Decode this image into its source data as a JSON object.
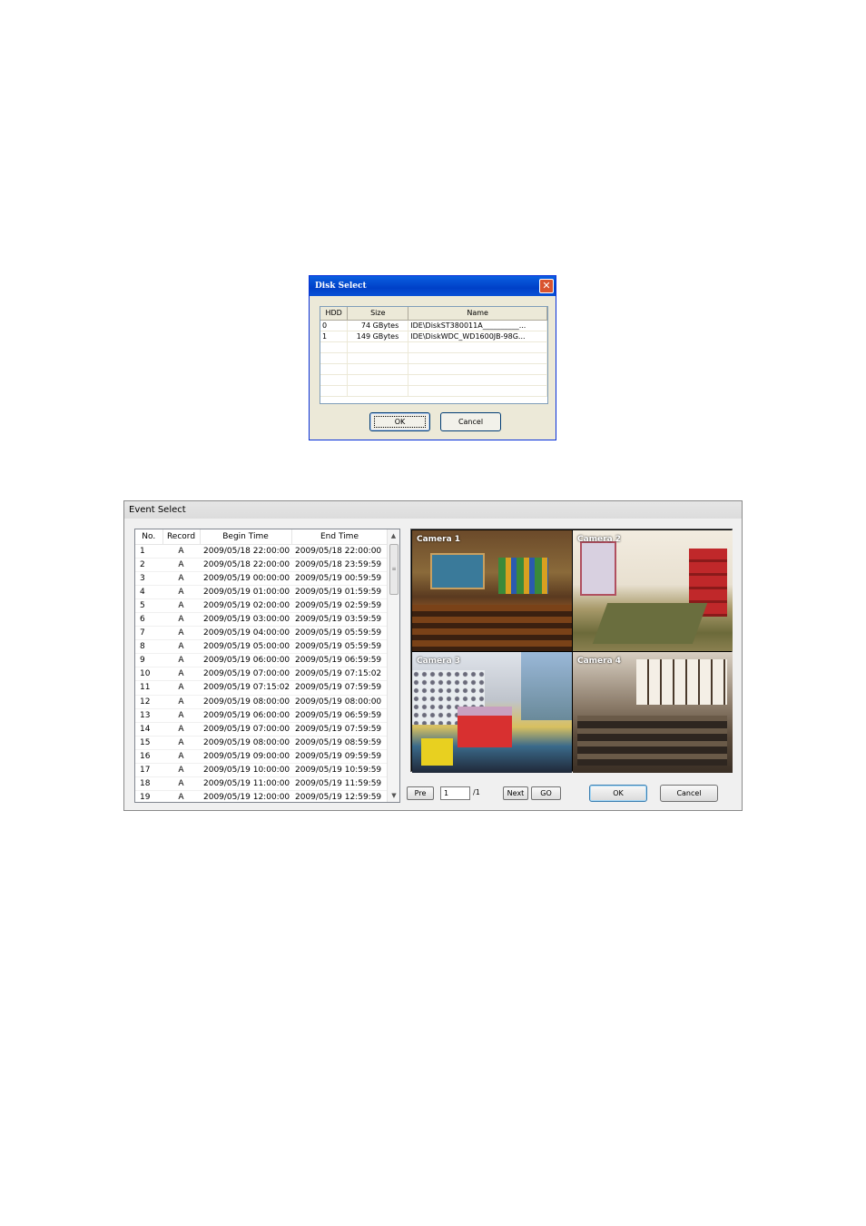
{
  "disk_select": {
    "title": "Disk Select",
    "close_glyph": "✕",
    "columns": [
      "HDD",
      "Size",
      "Name"
    ],
    "rows": [
      {
        "hdd": "0",
        "size": "74 GBytes",
        "name": "IDE\\DiskST380011A__________..."
      },
      {
        "hdd": "1",
        "size": "149 GBytes",
        "name": "IDE\\DiskWDC_WD1600JB-98G..."
      }
    ],
    "ok_label": "OK",
    "cancel_label": "Cancel"
  },
  "event_select": {
    "title": "Event Select",
    "columns": [
      "No.",
      "Record",
      "Begin Time",
      "End Time"
    ],
    "rows": [
      {
        "no": "1",
        "record": "A",
        "begin": "2009/05/18 22:00:00",
        "end": "2009/05/18 22:00:00"
      },
      {
        "no": "2",
        "record": "A",
        "begin": "2009/05/18 22:00:00",
        "end": "2009/05/18 23:59:59"
      },
      {
        "no": "3",
        "record": "A",
        "begin": "2009/05/19 00:00:00",
        "end": "2009/05/19 00:59:59"
      },
      {
        "no": "4",
        "record": "A",
        "begin": "2009/05/19 01:00:00",
        "end": "2009/05/19 01:59:59"
      },
      {
        "no": "5",
        "record": "A",
        "begin": "2009/05/19 02:00:00",
        "end": "2009/05/19 02:59:59"
      },
      {
        "no": "6",
        "record": "A",
        "begin": "2009/05/19 03:00:00",
        "end": "2009/05/19 03:59:59"
      },
      {
        "no": "7",
        "record": "A",
        "begin": "2009/05/19 04:00:00",
        "end": "2009/05/19 05:59:59"
      },
      {
        "no": "8",
        "record": "A",
        "begin": "2009/05/19 05:00:00",
        "end": "2009/05/19 05:59:59"
      },
      {
        "no": "9",
        "record": "A",
        "begin": "2009/05/19 06:00:00",
        "end": "2009/05/19 06:59:59"
      },
      {
        "no": "10",
        "record": "A",
        "begin": "2009/05/19 07:00:00",
        "end": "2009/05/19 07:15:02"
      },
      {
        "no": "11",
        "record": "A",
        "begin": "2009/05/19 07:15:02",
        "end": "2009/05/19 07:59:59"
      },
      {
        "no": "12",
        "record": "A",
        "begin": "2009/05/19 08:00:00",
        "end": "2009/05/19 08:00:00"
      },
      {
        "no": "13",
        "record": "A",
        "begin": "2009/05/19 06:00:00",
        "end": "2009/05/19 06:59:59"
      },
      {
        "no": "14",
        "record": "A",
        "begin": "2009/05/19 07:00:00",
        "end": "2009/05/19 07:59:59"
      },
      {
        "no": "15",
        "record": "A",
        "begin": "2009/05/19 08:00:00",
        "end": "2009/05/19 08:59:59"
      },
      {
        "no": "16",
        "record": "A",
        "begin": "2009/05/19 09:00:00",
        "end": "2009/05/19 09:59:59"
      },
      {
        "no": "17",
        "record": "A",
        "begin": "2009/05/19 10:00:00",
        "end": "2009/05/19 10:59:59"
      },
      {
        "no": "18",
        "record": "A",
        "begin": "2009/05/19 11:00:00",
        "end": "2009/05/19 11:59:59"
      },
      {
        "no": "19",
        "record": "A",
        "begin": "2009/05/19 12:00:00",
        "end": "2009/05/19 12:59:59"
      }
    ],
    "scroll_up_glyph": "▲",
    "scroll_down_glyph": "▼",
    "scroll_grip_glyph": "≡",
    "cameras": [
      {
        "label": "Camera 1"
      },
      {
        "label": "Camera 2"
      },
      {
        "label": "Camera 3"
      },
      {
        "label": "Camera 4"
      }
    ],
    "pre_label": "Pre",
    "page_value": "1",
    "page_total": "/1",
    "next_label": "Next",
    "go_label": "GO",
    "ok_label": "OK",
    "cancel_label": "Cancel"
  }
}
